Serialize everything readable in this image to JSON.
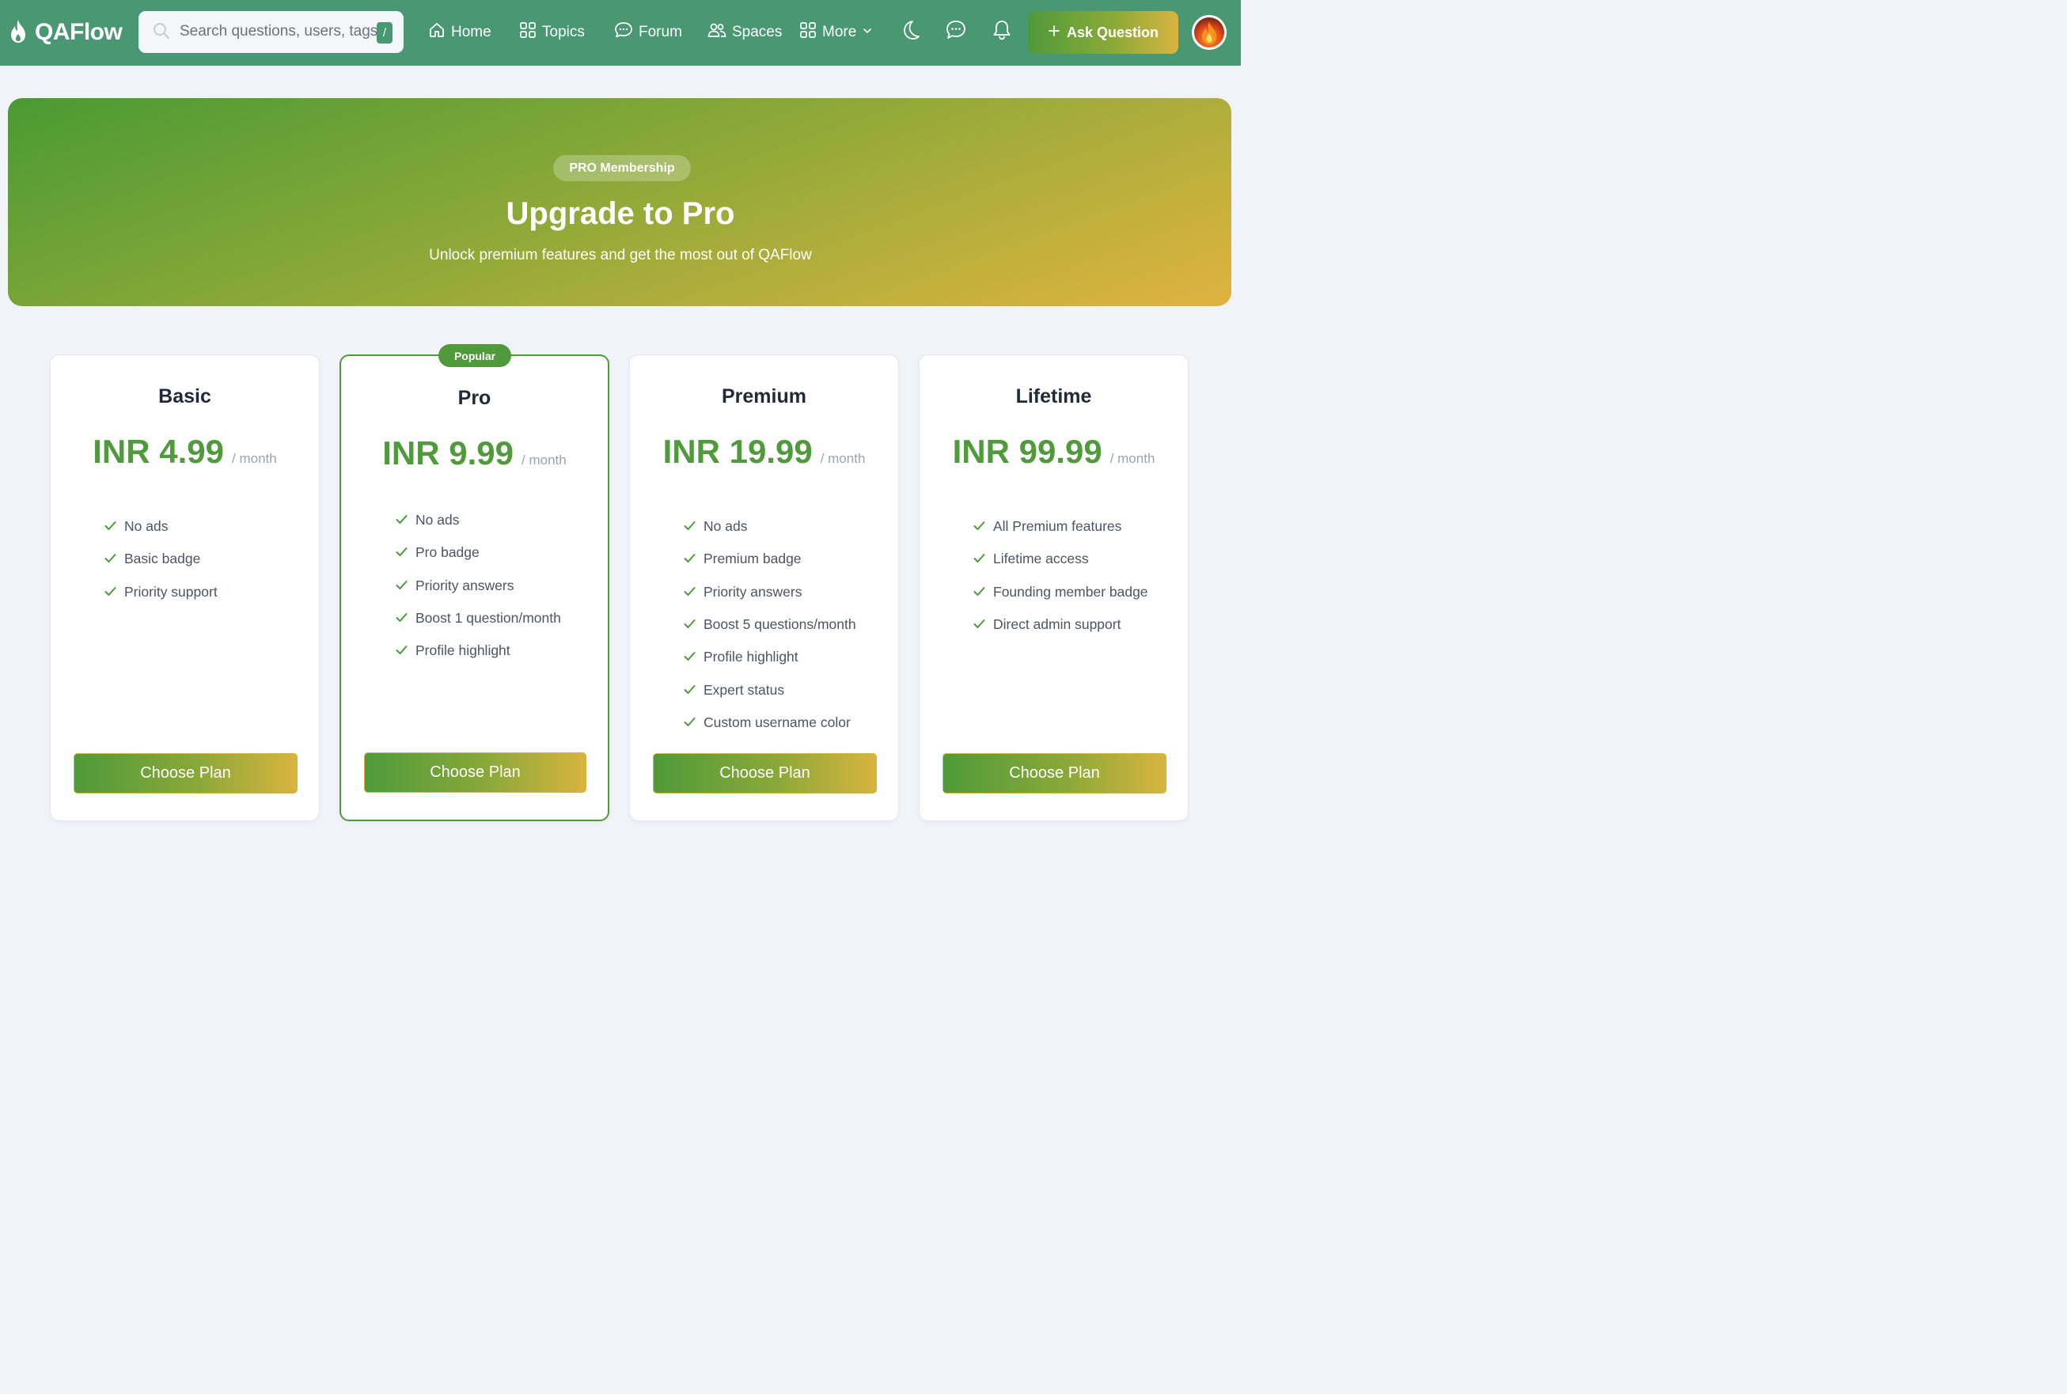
{
  "nav": {
    "brand": "QAFlow",
    "search_placeholder": "Search questions, users, tags...",
    "search_shortcut": "/",
    "links": {
      "home": "Home",
      "topics": "Topics",
      "forum": "Forum",
      "spaces": "Spaces",
      "more": "More"
    },
    "ask_label": "Ask Question",
    "colors": {
      "bar": "#4a9873",
      "accent": "#4f9a3a",
      "gold": "#d8b43f"
    }
  },
  "hero": {
    "badge": "PRO Membership",
    "title": "Upgrade to Pro",
    "subtitle": "Unlock premium features and get the most out of QAFlow"
  },
  "plans": [
    {
      "name": "Basic",
      "price": "INR 4.99",
      "period": "/ month",
      "features": [
        "No ads",
        "Basic badge",
        "Priority support"
      ],
      "cta": "Choose Plan"
    },
    {
      "name": "Pro",
      "badge": "Popular",
      "price": "INR 9.99",
      "period": "/ month",
      "features": [
        "No ads",
        "Pro badge",
        "Priority answers",
        "Boost 1 question/month",
        "Profile highlight"
      ],
      "cta": "Choose Plan"
    },
    {
      "name": "Premium",
      "price": "INR 19.99",
      "period": "/ month",
      "features": [
        "No ads",
        "Premium badge",
        "Priority answers",
        "Boost 5 questions/month",
        "Profile highlight",
        "Expert status",
        "Custom username color"
      ],
      "cta": "Choose Plan"
    },
    {
      "name": "Lifetime",
      "price": "INR 99.99",
      "period": "/ month",
      "features": [
        "All Premium features",
        "Lifetime access",
        "Founding member badge",
        "Direct admin support"
      ],
      "cta": "Choose Plan"
    }
  ]
}
